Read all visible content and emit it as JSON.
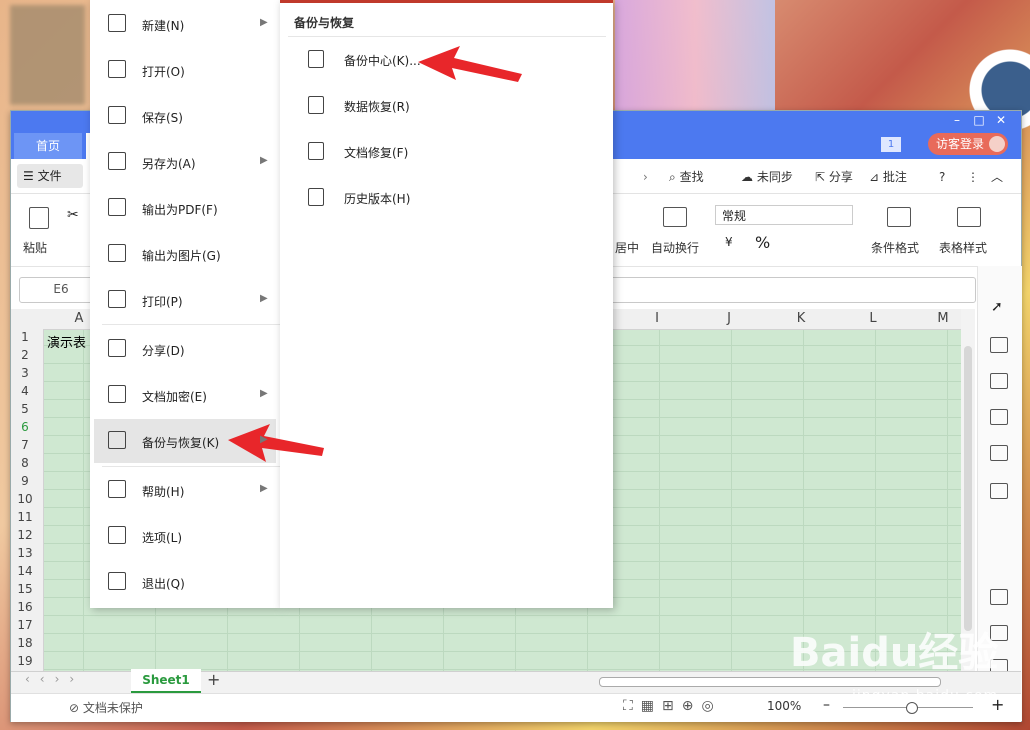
{
  "window": {
    "home_tab": "首页",
    "badge": "1",
    "login": "访客登录"
  },
  "menubar": {
    "file": "文件",
    "search": "查找",
    "sync": "未同步",
    "share": "分享",
    "comment": "批注",
    "help": "?"
  },
  "ribbon": {
    "paste": "粘贴",
    "center": "居中",
    "wrap": "自动换行",
    "number_format": "常规",
    "cond_format": "条件格式",
    "table_style": "表格样式"
  },
  "formula_bar": {
    "cell_ref": "E6"
  },
  "sheet": {
    "columns": [
      "A",
      "I",
      "J",
      "K",
      "L",
      "M"
    ],
    "rows": [
      "1",
      "2",
      "3",
      "4",
      "5",
      "6",
      "7",
      "8",
      "9",
      "10",
      "11",
      "12",
      "13",
      "14",
      "15",
      "16",
      "17",
      "18",
      "19"
    ],
    "a1_text": "演示表",
    "tab": "Sheet1"
  },
  "status": {
    "protect": "文档未保护",
    "zoom": "100%"
  },
  "file_menu": {
    "items": [
      {
        "label": "新建(N)",
        "icon": "new-file-icon",
        "has_sub": true
      },
      {
        "label": "打开(O)",
        "icon": "folder-open-icon",
        "has_sub": false
      },
      {
        "label": "保存(S)",
        "icon": "save-icon",
        "has_sub": false
      },
      {
        "label": "另存为(A)",
        "icon": "save-as-icon",
        "has_sub": true
      },
      {
        "label": "输出为PDF(F)",
        "icon": "pdf-export-icon",
        "has_sub": false
      },
      {
        "label": "输出为图片(G)",
        "icon": "image-export-icon",
        "has_sub": false
      },
      {
        "label": "打印(P)",
        "icon": "print-icon",
        "has_sub": true
      },
      {
        "label": "分享(D)",
        "icon": "share-icon",
        "has_sub": false
      },
      {
        "label": "文档加密(E)",
        "icon": "encrypt-icon",
        "has_sub": true
      },
      {
        "label": "备份与恢复(K)",
        "icon": "backup-icon",
        "has_sub": true
      },
      {
        "label": "帮助(H)",
        "icon": "help-icon",
        "has_sub": true
      },
      {
        "label": "选项(L)",
        "icon": "gear-icon",
        "has_sub": false
      },
      {
        "label": "退出(Q)",
        "icon": "exit-icon",
        "has_sub": false
      }
    ]
  },
  "submenu": {
    "title": "备份与恢复",
    "items": [
      {
        "label": "备份中心(K)...",
        "icon": "backup-center-icon"
      },
      {
        "label": "数据恢复(R)",
        "icon": "data-restore-icon"
      },
      {
        "label": "文档修复(F)",
        "icon": "doc-repair-icon"
      },
      {
        "label": "历史版本(H)",
        "icon": "history-version-icon"
      }
    ]
  },
  "watermark": {
    "brand": "Baidu经验",
    "url": "jingyan.baidu.com"
  },
  "colors": {
    "titlebar": "#4c79f0",
    "grid_fill": "#cfe8d1",
    "sheet_tab": "#2a9a3e",
    "arrow": "#e8262a",
    "submenu_accent": "#c0392b"
  }
}
